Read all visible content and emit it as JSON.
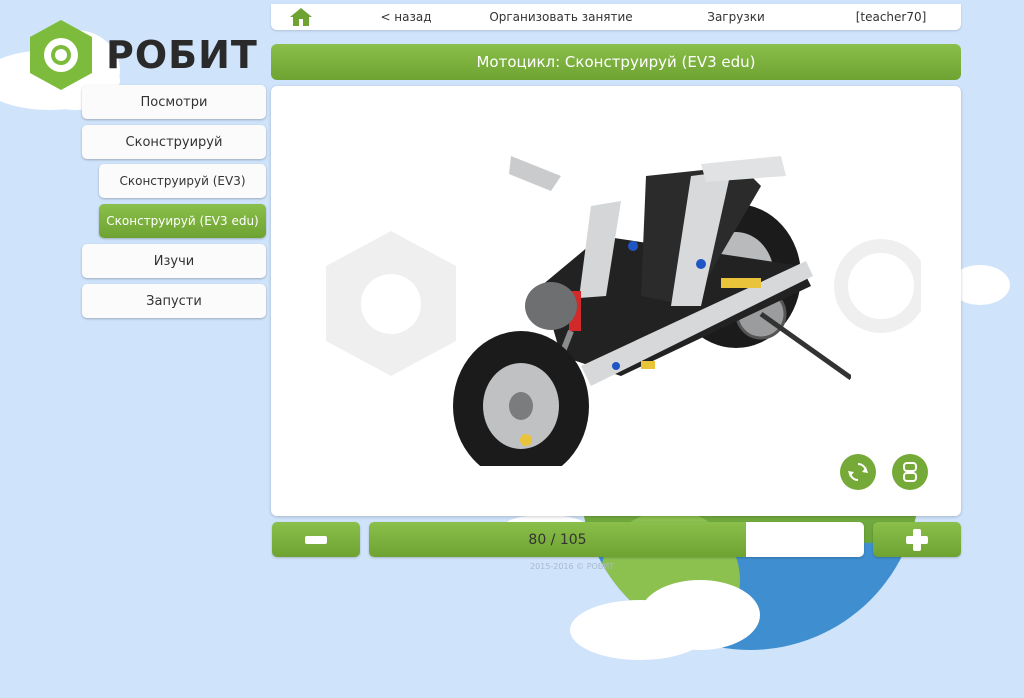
{
  "brand": {
    "name": "РОБИТ"
  },
  "topnav": {
    "home_icon": "home-icon",
    "back": "< назад",
    "organize": "Организовать занятие",
    "downloads": "Загрузки",
    "user": "[teacher70]"
  },
  "title": "Мотоцикл: Сконструируй (EV3 edu)",
  "sidebar": {
    "items": [
      {
        "label": "Посмотри"
      },
      {
        "label": "Сконструируй"
      },
      {
        "label": "Сконструируй (EV3)"
      },
      {
        "label": "Сконструируй (EV3 edu)"
      },
      {
        "label": "Изучи"
      },
      {
        "label": "Запусти"
      }
    ],
    "active_index": 3
  },
  "viewer": {
    "rotate_icon": "rotate-icon",
    "part_icon": "part-icon"
  },
  "controls": {
    "minus_icon": "minus-icon",
    "plus_icon": "plus-icon",
    "progress_text": "80 / 105",
    "current": 80,
    "total": 105
  },
  "footer": "2015-2016 © РОБИТ",
  "colors": {
    "accent": "#76aa38",
    "background": "#cfe3fb"
  }
}
